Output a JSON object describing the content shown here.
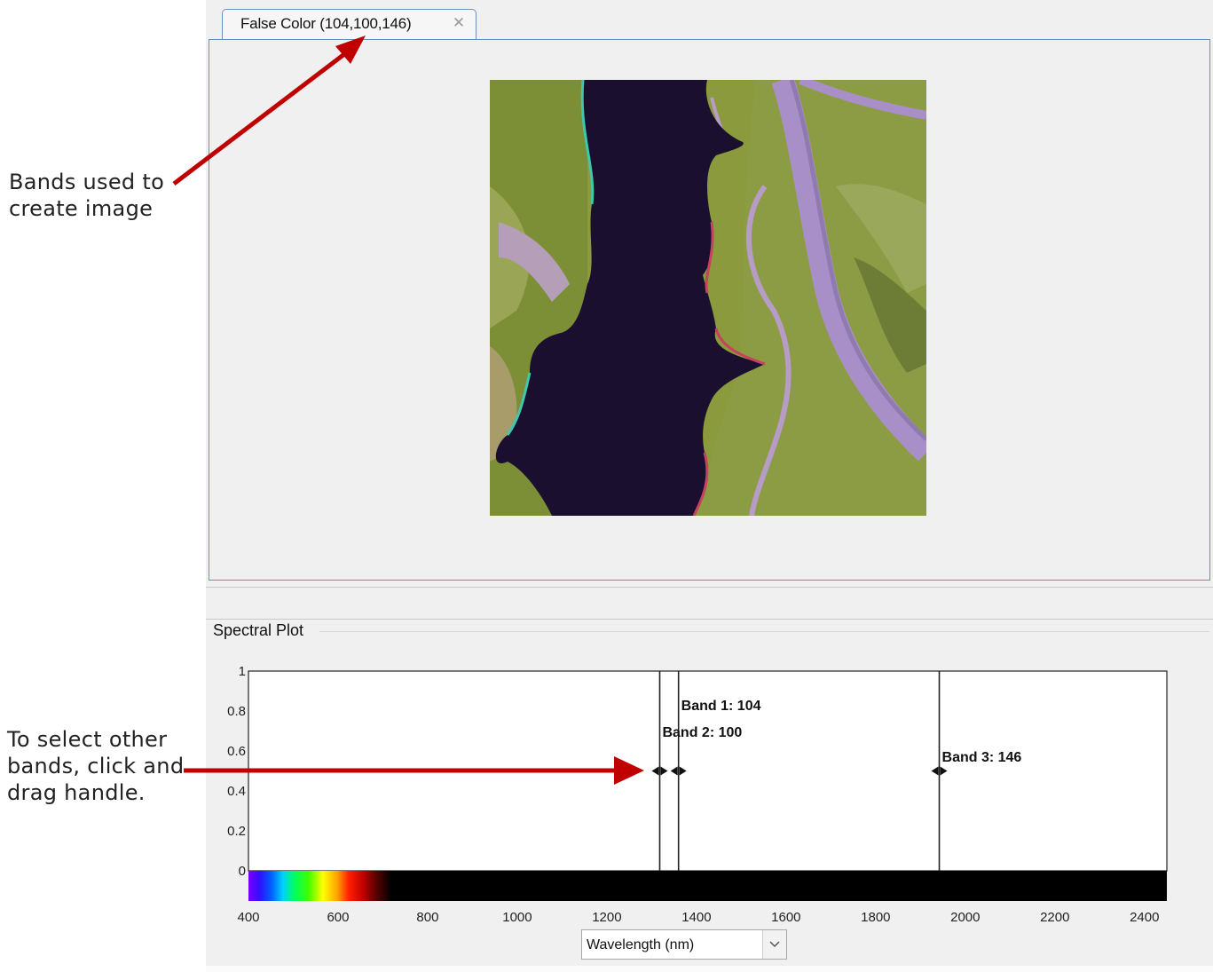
{
  "tab": {
    "label": "False Color (104,100,146)"
  },
  "panel": {
    "spectral_title": "Spectral Plot"
  },
  "wavelength_select": {
    "selected": "Wavelength (nm)"
  },
  "annotations": {
    "bands_line1": "Bands used to",
    "bands_line2": "create image",
    "select_line1": "To select other",
    "select_line2": "bands, click and",
    "select_line3": "drag handle."
  },
  "colors": {
    "annotation_arrow": "#c00000",
    "panel_border": "#6c8fb8",
    "panel_bg": "#f0f0f0"
  },
  "chart_data": {
    "type": "line",
    "xlabel": "Wavelength (nm)",
    "xlim": [
      400,
      2450
    ],
    "ylim": [
      0,
      1
    ],
    "x_ticks": [
      400,
      600,
      800,
      1000,
      1200,
      1400,
      1600,
      1800,
      2000,
      2200,
      2400
    ],
    "y_ticks": [
      0,
      0.2,
      0.4,
      0.6,
      0.8,
      1
    ],
    "y_tick_labels": [
      "0",
      "0.2",
      "0.4",
      "0.6",
      "0.8",
      "1"
    ],
    "band_markers": [
      {
        "label": "Band 1: 104",
        "band": 104,
        "wavelength": 1360
      },
      {
        "label": "Band 2: 100",
        "band": 100,
        "wavelength": 1318
      },
      {
        "label": "Band 3: 146",
        "band": 146,
        "wavelength": 1942
      }
    ],
    "handle_y": 0.5,
    "spectrum_bar": {
      "visible_start": 400,
      "visible_end": 720
    }
  }
}
